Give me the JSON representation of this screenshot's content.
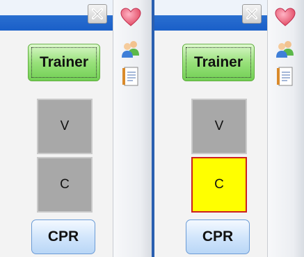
{
  "colors": {
    "trainer_green": "#98e17a",
    "button_gray": "#a8a8a8",
    "active_yellow": "#ffff00",
    "active_border_red": "#cc1f1f",
    "cpr_blue": "#cfe4fb",
    "title_blue": "#2a6fd0"
  },
  "icons": {
    "close": "close-icon",
    "heart": "heart-icon",
    "users": "users-icon",
    "notes": "notes-icon"
  },
  "panels": [
    {
      "trainer_label": "Trainer",
      "v_label": "V",
      "c_label": "C",
      "c_active": false,
      "cpr_label": "CPR"
    },
    {
      "trainer_label": "Trainer",
      "v_label": "V",
      "c_label": "C",
      "c_active": true,
      "cpr_label": "CPR"
    }
  ]
}
